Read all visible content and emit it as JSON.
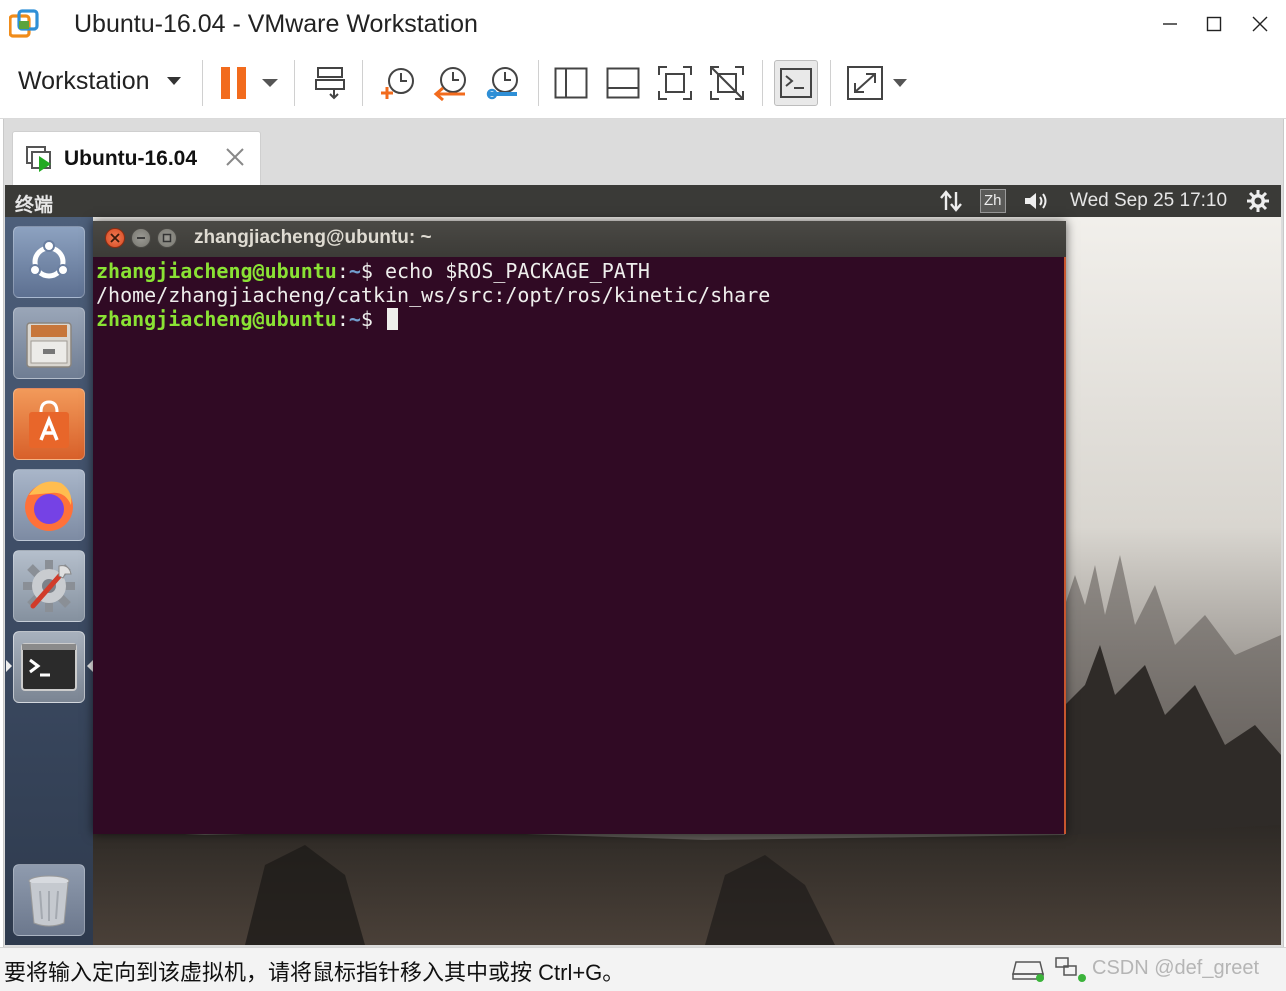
{
  "window": {
    "title": "Ubuntu-16.04 - VMware Workstation",
    "minimize_icon": "minimize-icon",
    "maximize_icon": "maximize-icon",
    "close_icon": "close-icon"
  },
  "toolbar": {
    "menu_label": "Workstation",
    "buttons": [
      {
        "name": "pause-button",
        "icon": "pause-icon",
        "color": "#f26b1d"
      },
      {
        "name": "send-ctrl-alt-del-button",
        "icon": "send-keys-icon"
      },
      {
        "name": "take-snapshot-button",
        "icon": "snapshot-add-icon"
      },
      {
        "name": "revert-snapshot-button",
        "icon": "snapshot-revert-icon"
      },
      {
        "name": "snapshot-manager-button",
        "icon": "snapshot-manager-icon"
      },
      {
        "name": "show-library-button",
        "icon": "library-icon"
      },
      {
        "name": "show-thumbnail-button",
        "icon": "thumbnail-bar-icon"
      },
      {
        "name": "full-screen-button",
        "icon": "fullscreen-icon"
      },
      {
        "name": "unity-button",
        "icon": "unity-icon"
      },
      {
        "name": "console-view-button",
        "icon": "console-icon"
      },
      {
        "name": "stretch-guest-button",
        "icon": "stretch-icon"
      }
    ]
  },
  "vm_tab": {
    "label": "Ubuntu-16.04",
    "icon": "vm-running-icon"
  },
  "guest": {
    "topbar": {
      "title": "终端",
      "ime": "Zh",
      "clock": "Wed Sep 25 17:10",
      "icons": [
        "network-icon",
        "volume-icon",
        "gear-icon"
      ]
    },
    "launcher": {
      "items": [
        {
          "name": "dash-home",
          "icon": "ubuntu-logo-icon"
        },
        {
          "name": "files",
          "icon": "file-cabinet-icon"
        },
        {
          "name": "software-center",
          "icon": "shopping-bag-icon"
        },
        {
          "name": "firefox",
          "icon": "firefox-icon"
        },
        {
          "name": "system-settings",
          "icon": "settings-wrench-icon"
        },
        {
          "name": "terminal",
          "icon": "terminal-icon"
        },
        {
          "name": "trash",
          "icon": "trash-icon"
        }
      ]
    },
    "terminal": {
      "title": "zhangjiacheng@ubuntu: ~",
      "lines": [
        {
          "user": "zhangjiacheng@ubuntu",
          "sep": ":",
          "path": "~",
          "prompt": "$ ",
          "cmd": "echo $ROS_PACKAGE_PATH"
        },
        {
          "output": "/home/zhangjiacheng/catkin_ws/src:/opt/ros/kinetic/share"
        },
        {
          "user": "zhangjiacheng@ubuntu",
          "sep": ":",
          "path": "~",
          "prompt": "$ ",
          "cmd": ""
        }
      ],
      "colors": {
        "background": "#300a24",
        "user": "#8ae234",
        "path": "#729fcf",
        "text": "#eeeeec"
      }
    }
  },
  "statusbar": {
    "message": "要将输入定向到该虚拟机，请将鼠标指针移入其中或按 Ctrl+G。",
    "watermark": "CSDN @def_greet"
  }
}
